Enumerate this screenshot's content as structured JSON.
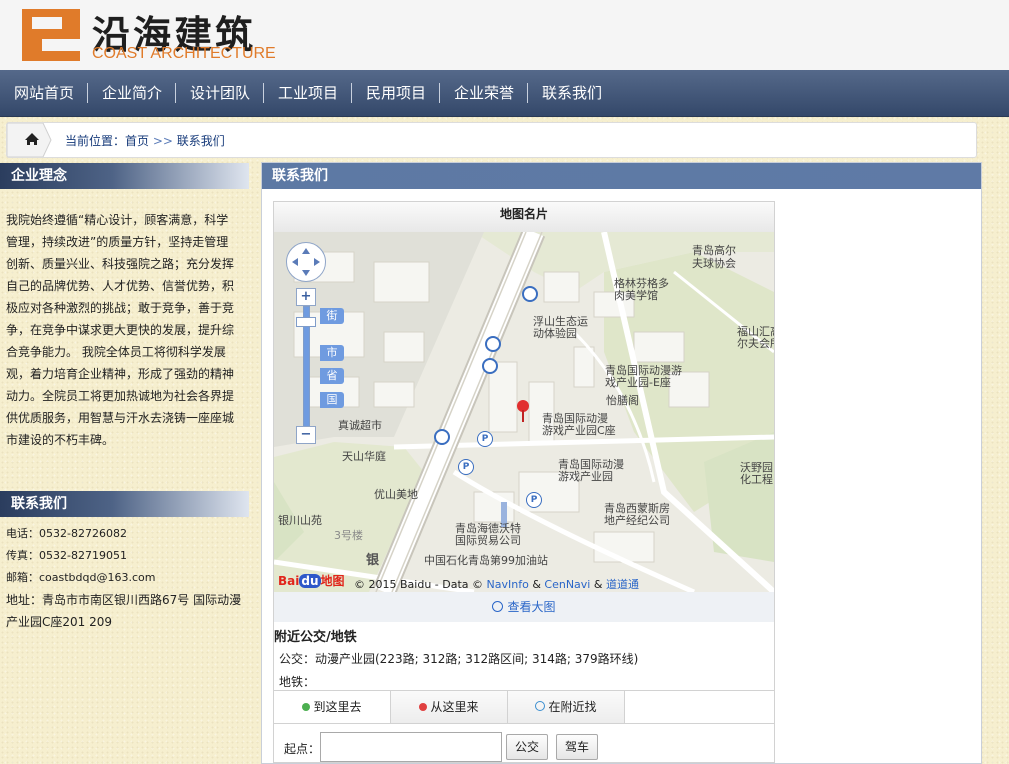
{
  "brand": {
    "name_cn": "沿海建筑",
    "name_en": "COAST ARCHITECTURE"
  },
  "nav": [
    "网站首页",
    "企业简介",
    "设计团队",
    "工业项目",
    "民用项目",
    "企业荣誉",
    "联系我们"
  ],
  "breadcrumb": {
    "prefix": "当前位置：",
    "home": "首页",
    "sep": ">>",
    "current": "联系我们"
  },
  "sidebar": {
    "philosophy_title": "企业理念",
    "philosophy_lines": [
      "我院始终遵循“精心设计，顾客满意，科学",
      "管理，持续改进”的质量方针，坚持走管理",
      "创新、质量兴业、科技强院之路；充分发挥",
      "自己的品牌优势、人才优势、信誉优势，积",
      "极应对各种激烈的挑战；敢于竞争，善于竞",
      "争，在竞争中谋求更大更快的发展，提升综",
      "合竞争能力。 我院全体员工将彻科学发展",
      "观，着力培育企业精神，形成了强劲的精神",
      "动力。全院员工将更加热诚地为社会各界提",
      "供优质服务，用智慧与汗水去浇铸一座座城",
      "市建设的不朽丰碑。"
    ],
    "contact_title": "联系我们",
    "contact_lines": [
      "电话：0532-82726082",
      "传真：0532-82719051",
      "邮箱：coastbdqd@163.com",
      "地址：青岛市市南区银川西路67号 国际动漫",
      "产业园C座201 209"
    ]
  },
  "main": {
    "title": "联系我们",
    "card_title": "地图名片",
    "map": {
      "zoom_tags": [
        "街",
        "市",
        "省",
        "国"
      ],
      "zoom_in": "+",
      "zoom_out": "−",
      "pois": [
        "青岛高尔",
        "夫球协会",
        "格林芬格多",
        "肉美学馆",
        "浮山生态运",
        "动体验园",
        "福山汇高",
        "尔夫会所",
        "青岛国际动漫游",
        "戏产业园-E座",
        "怡膳阁",
        "青岛国际动漫",
        "游戏产业园C座",
        "真诚超市",
        "天山华庭",
        "青岛国际动漫",
        "游戏产业园",
        "沃野园",
        "化工程",
        "优山美地",
        "银川山苑",
        "3号楼",
        "青岛西蒙斯房",
        "地产经纪公司",
        "青岛海德沃特",
        "国际贸易公司",
        "中国石化青岛第99加油站",
        "银"
      ],
      "copyright": "© 2015 Baidu - Data © ",
      "credit_navinfo": "NavInfo",
      "credit_amp1": " & ",
      "credit_cennavi": "CenNavi",
      "credit_amp2": " & ",
      "credit_daodao": "道道通",
      "logo_text": "Bai",
      "logo_du": "du",
      "logo_map": "地图"
    },
    "view_bigmap": "查看大图",
    "transit_title": "附近公交/地铁",
    "bus_line": "公交：动漫产业园(223路; 312路; 312路区间; 314路; 379路环线)",
    "subway_line": "地铁：",
    "tabs": [
      "到这里去",
      "从这里来",
      "在附近找"
    ],
    "start_label": "起点：",
    "start_value": "",
    "btn_bus": "公交",
    "btn_drive": "驾车"
  },
  "colors": {
    "accent_orange": "#e07b2a",
    "nav_blue": "#3c5075",
    "link_blue": "#2a66c8"
  }
}
